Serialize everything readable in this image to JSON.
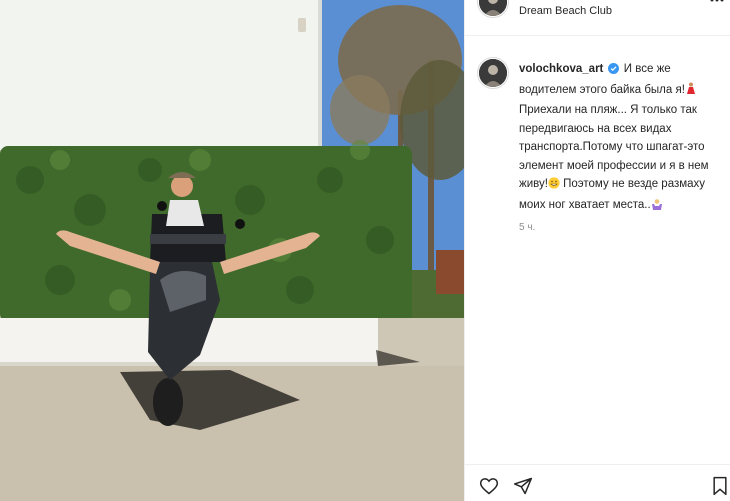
{
  "post": {
    "location": "Dream Beach Club",
    "author": "volochkova_art",
    "caption": "И все же водителем этого байка была я!",
    "caption_parts": [
      " Приехали на пляж... Я только так передвигаюсь на всех видах транспорта.Потому что шпагат-это элемент моей профессии и я в нем живу!",
      " Поэтому не везде размаху моих ног хватает места.."
    ],
    "timestamp": "5 ч."
  },
  "icons": {
    "verified": "verified-badge-icon",
    "like": "heart-icon",
    "share": "paper-plane-icon",
    "save": "bookmark-icon",
    "more": "more-options-icon"
  },
  "colors": {
    "verified": "#3897f0",
    "muted": "#8e8e8e",
    "text": "#262626"
  }
}
